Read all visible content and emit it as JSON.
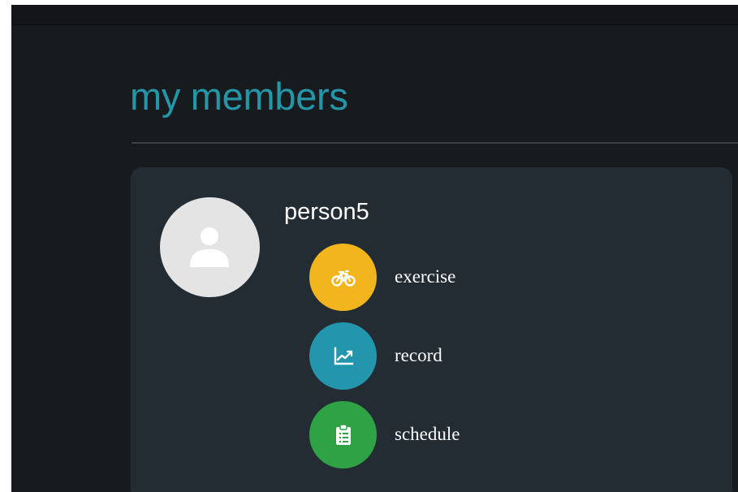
{
  "page": {
    "title": "my members"
  },
  "member": {
    "name": "person5",
    "avatar_icon": "person-icon"
  },
  "actions": [
    {
      "label": "exercise",
      "icon": "bicycle-icon",
      "color": "#f2b51d"
    },
    {
      "label": "record",
      "icon": "line-chart-icon",
      "color": "#2396ad"
    },
    {
      "label": "schedule",
      "icon": "clipboard-list-icon",
      "color": "#2fa245"
    }
  ],
  "colors": {
    "background": "#181b1e",
    "card": "#232b33",
    "title_accent": "#2596a8",
    "avatar_bg": "#e4e4e4"
  }
}
